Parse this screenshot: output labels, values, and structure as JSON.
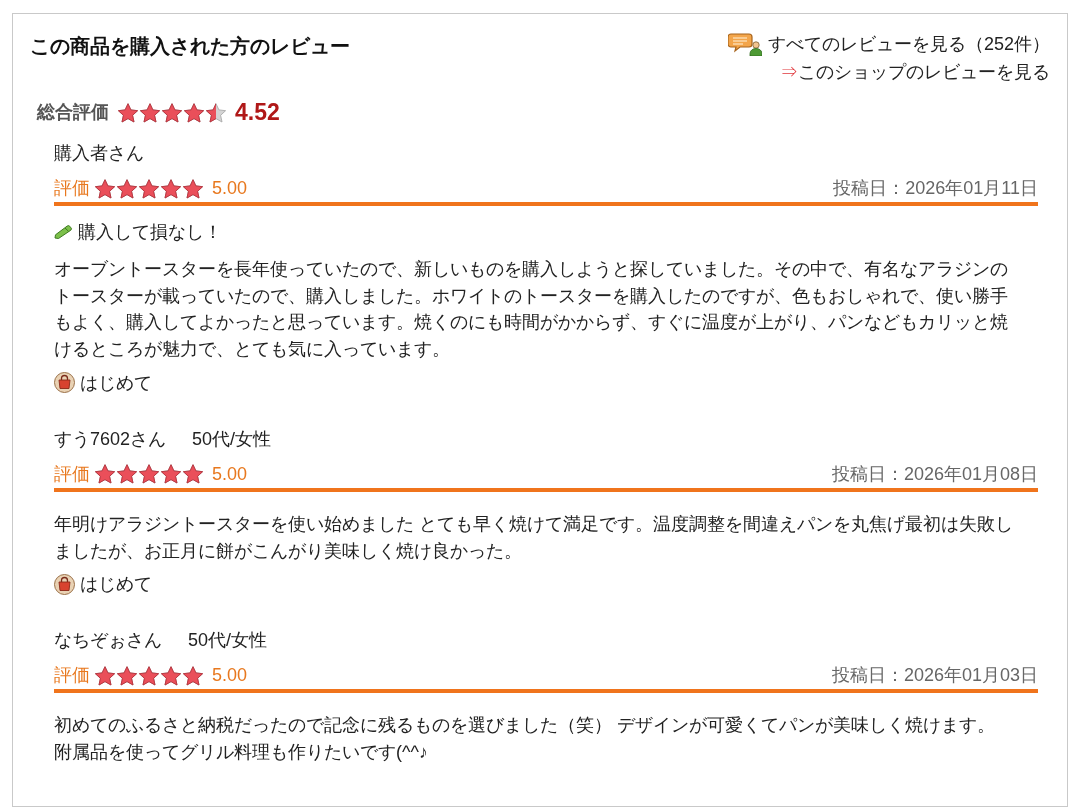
{
  "header": {
    "title": "この商品を購入された方のレビュー",
    "all_reviews_link": "すべてのレビューを見る（252件）",
    "shop_reviews_link": {
      "arrow": "⇒",
      "label": "このショップのレビューを見る"
    }
  },
  "overall": {
    "label": "総合評価",
    "stars": 4.5,
    "score": "4.52"
  },
  "reviews": [
    {
      "reviewer": "購入者さん",
      "rating_label": "評価",
      "stars": 5,
      "rating": "5.00",
      "date": "投稿日：2026年01月11日",
      "title": "購入して損なし！",
      "body": [
        "オーブントースターを長年使っていたので、新しいものを購入しようと探していました。その中で、有名なアラジンのトースターが載っていたので、購入しました。ホワイトのトースターを購入したのですが、色もおしゃれで、使い勝手もよく、購入してよかったと思っています。焼くのにも時間がかからず、すぐに温度が上がり、パンなどもカリッと焼けるところが魅力で、とても気に入っています。"
      ],
      "tag": "はじめて"
    },
    {
      "reviewer": "すう7602さん",
      "profile": "50代/女性",
      "rating_label": "評価",
      "stars": 5,
      "rating": "5.00",
      "date": "投稿日：2026年01月08日",
      "body": [
        "年明けアラジントースターを使い始めました とても早く焼けて満足です。温度調整を間違えパンを丸焦げ最初は失敗しましたが、お正月に餅がこんがり美味しく焼け良かった。"
      ],
      "tag": "はじめて"
    },
    {
      "reviewer": "なちぞぉさん",
      "profile": "50代/女性",
      "rating_label": "評価",
      "stars": 5,
      "rating": "5.00",
      "date": "投稿日：2026年01月03日",
      "body": [
        "初めてのふるさと納税だったので記念に残るものを選びました（笑） デザインが可愛くてパンが美味しく焼けます。",
        "附属品を使ってグリル料理も作りたいです(^^♪"
      ]
    }
  ]
}
